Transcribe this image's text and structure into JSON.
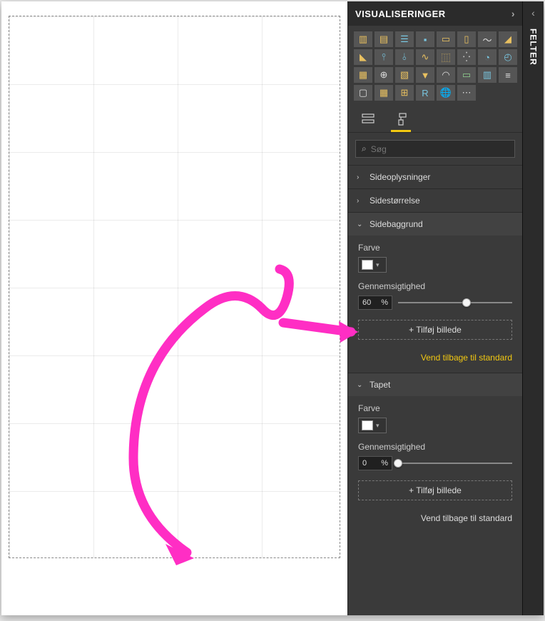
{
  "panel": {
    "title": "VISUALISERINGER",
    "tabs": {
      "fields_icon": "fields-icon",
      "format_icon": "paint-roller-icon"
    },
    "search_placeholder": "Søg",
    "sections": {
      "page_info": {
        "label": "Sideoplysninger",
        "expanded": false
      },
      "page_size": {
        "label": "Sidestørrelse",
        "expanded": false
      },
      "page_bg": {
        "label": "Sidebaggrund",
        "expanded": true,
        "color_label": "Farve",
        "color_value": "#FFFFFF",
        "transparency_label": "Gennemsigtighed",
        "transparency_value": "60",
        "transparency_unit": "%",
        "add_image": "+ Tilføj billede",
        "revert": "Vend tilbage til standard"
      },
      "wallpaper": {
        "label": "Tapet",
        "expanded": true,
        "color_label": "Farve",
        "color_value": "#FFFFFF",
        "transparency_label": "Gennemsigtighed",
        "transparency_value": "0",
        "transparency_unit": "%",
        "add_image": "+ Tilføj billede",
        "revert": "Vend tilbage til standard"
      }
    }
  },
  "side_panel": {
    "title": "FELTER"
  },
  "annotation": {
    "color": "#ff2ec4"
  }
}
